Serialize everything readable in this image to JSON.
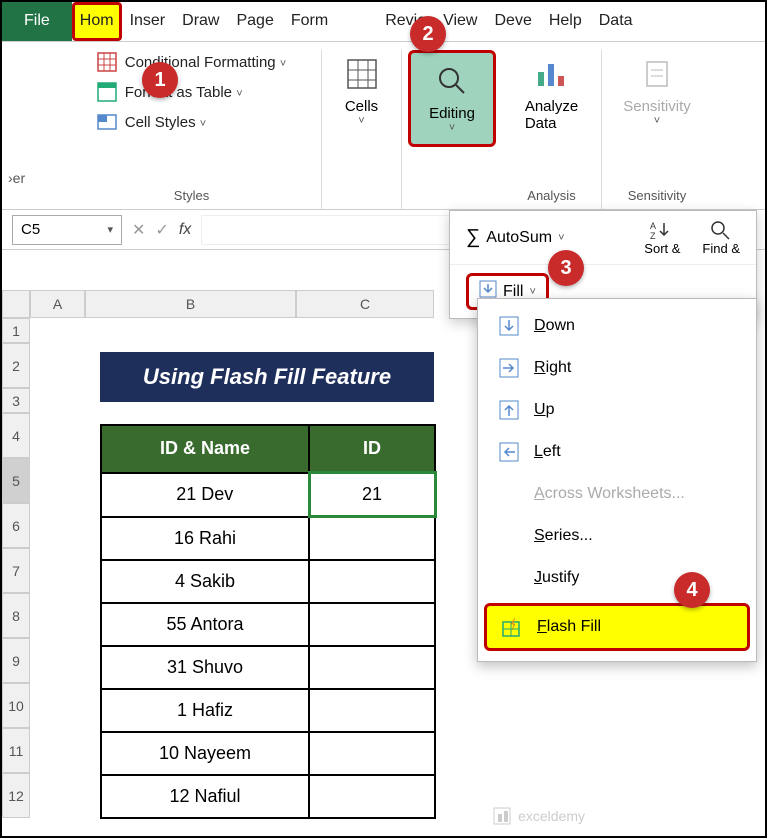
{
  "tabs": {
    "file": "File",
    "items": [
      "Hom",
      "Inser",
      "Draw",
      "Page",
      "Form",
      "",
      "Revie",
      "View",
      "Deve",
      "Help",
      "Data"
    ]
  },
  "ribbon": {
    "clipboard_label": "›er",
    "styles": {
      "cond_format": "Conditional Formatting",
      "format_table": "Format as Table",
      "cell_styles": "Cell Styles",
      "group_label": "Styles"
    },
    "cells": "Cells",
    "editing": "Editing",
    "analyze": "Analyze Data",
    "analysis_label": "Analysis",
    "sensitivity": "Sensitivity",
    "sensitivity_label": "Sensitivity"
  },
  "formula_bar": {
    "namebox": "C5",
    "value": ""
  },
  "edit_panel": {
    "autosum": "AutoSum",
    "fill": "Fill",
    "sort": "Sort &",
    "find": "Find &"
  },
  "fill_menu": {
    "down": "Down",
    "right": "Right",
    "up": "Up",
    "left": "Left",
    "across": "Across Worksheets...",
    "series": "Series...",
    "justify": "Justify",
    "flash": "Flash Fill"
  },
  "sheet": {
    "cols": [
      "A",
      "B",
      "C"
    ],
    "rows": [
      "1",
      "2",
      "3",
      "4",
      "5",
      "6",
      "7",
      "8",
      "9",
      "10",
      "11",
      "12"
    ]
  },
  "table": {
    "title": "Using Flash Fill Feature",
    "headers": [
      "ID & Name",
      "ID"
    ],
    "rows": [
      {
        "name": "21 Dev",
        "id": "21"
      },
      {
        "name": "16 Rahi",
        "id": ""
      },
      {
        "name": "4 Sakib",
        "id": ""
      },
      {
        "name": "55 Antora",
        "id": ""
      },
      {
        "name": "31 Shuvo",
        "id": ""
      },
      {
        "name": "1 Hafiz",
        "id": ""
      },
      {
        "name": "10 Nayeem",
        "id": ""
      },
      {
        "name": "12 Nafiul",
        "id": ""
      }
    ]
  },
  "badges": [
    "1",
    "2",
    "3",
    "4"
  ],
  "watermark": "exceldemy"
}
